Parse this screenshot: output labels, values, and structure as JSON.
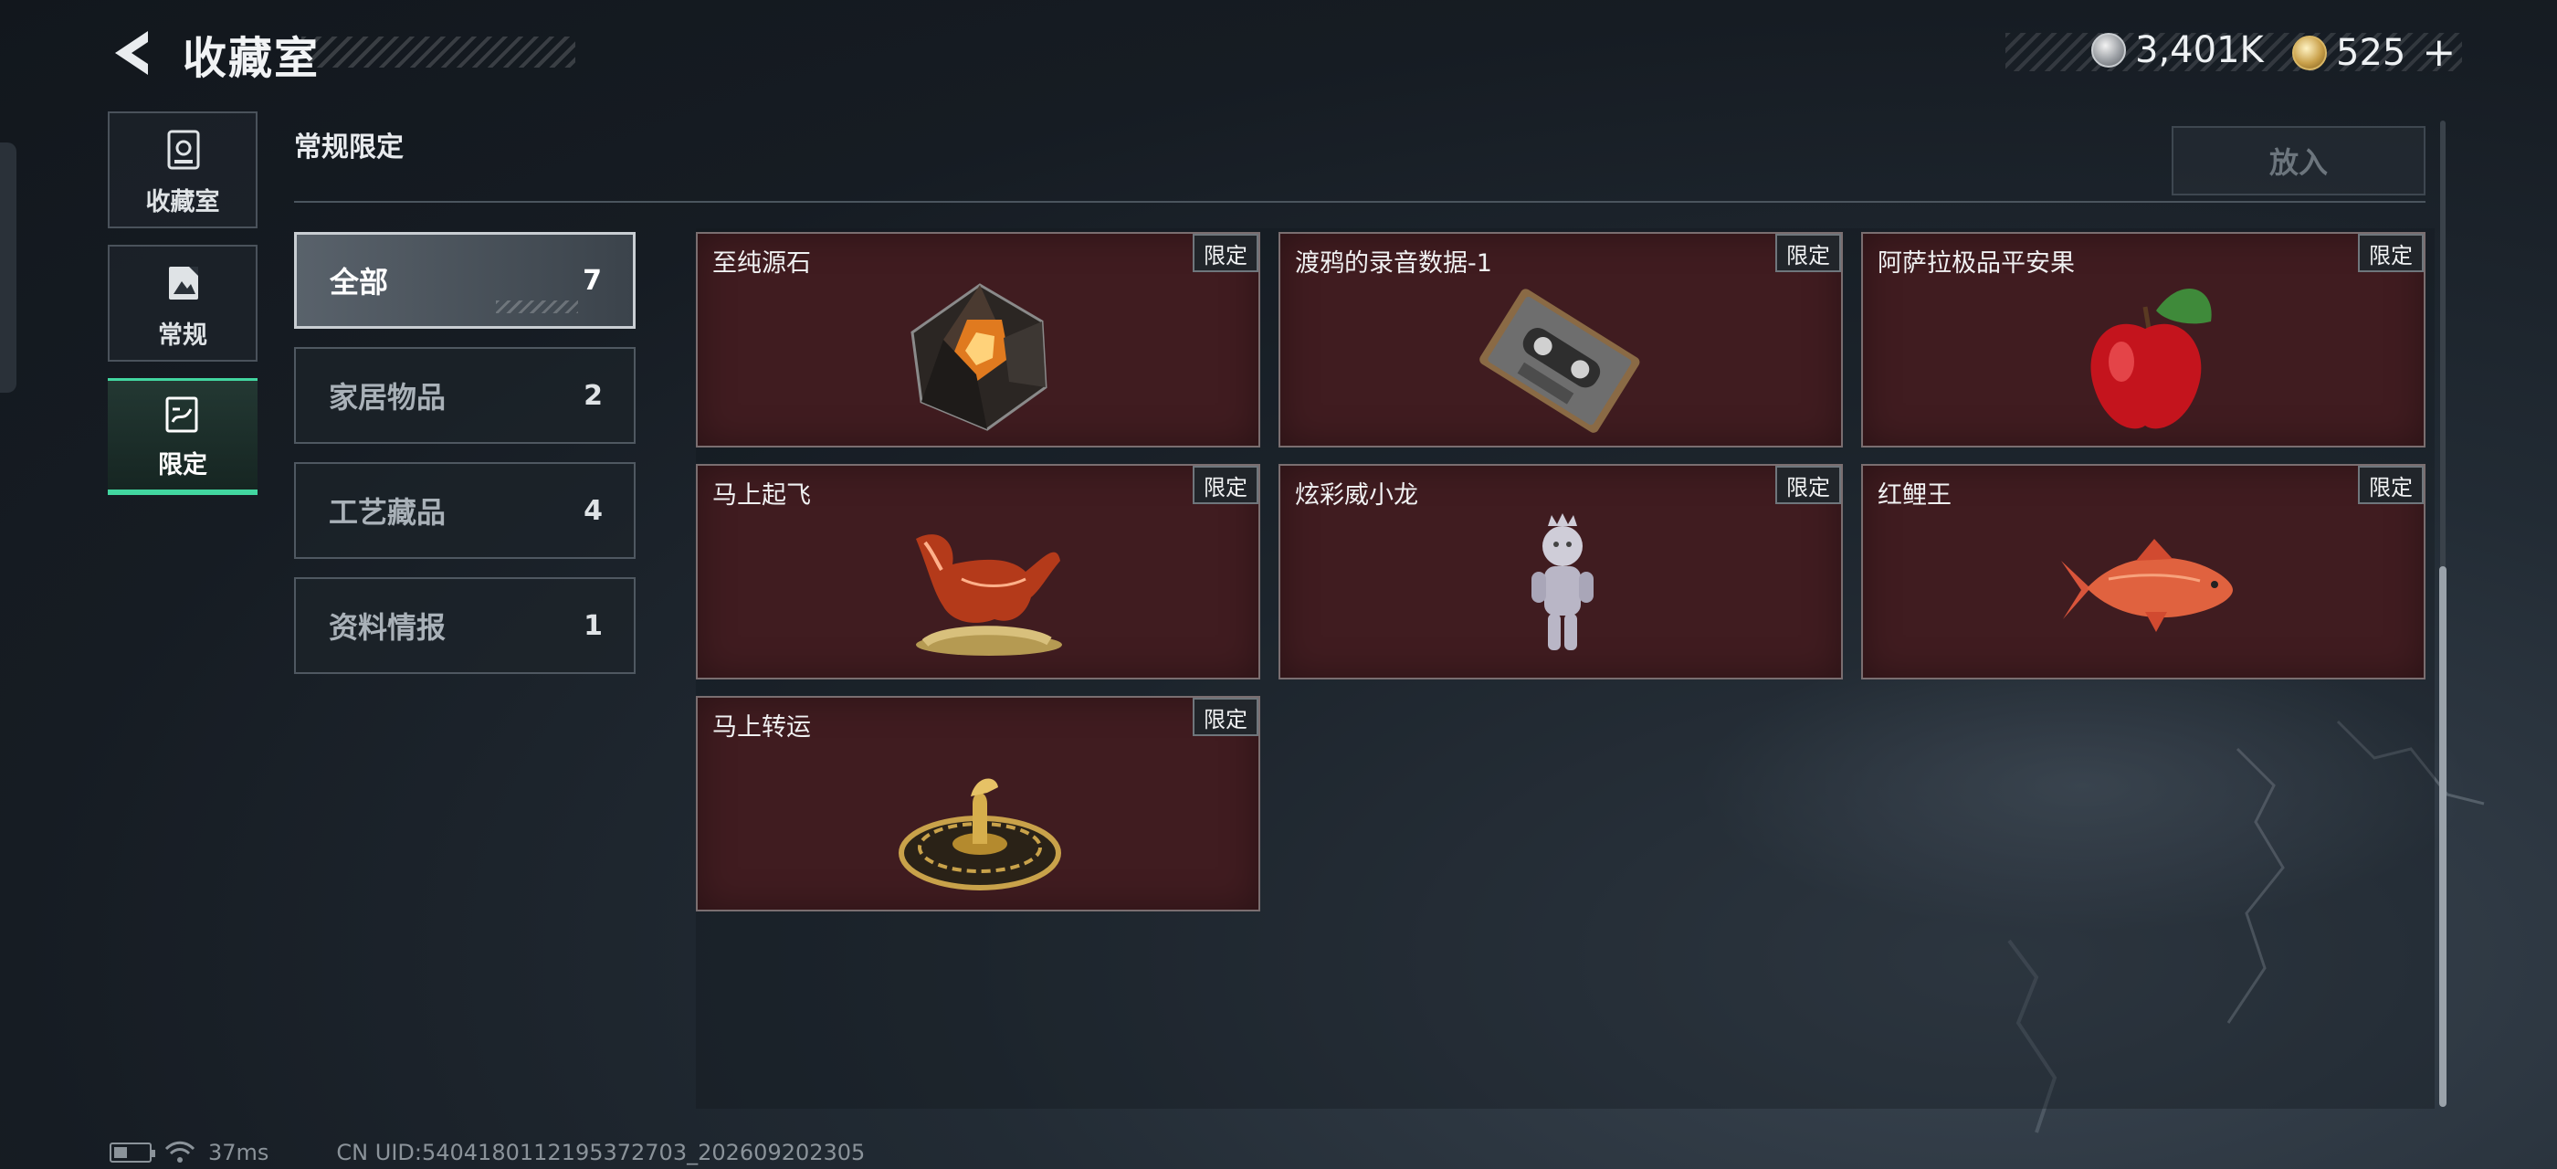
{
  "header": {
    "title": "收藏室",
    "currency_silver": "3,401K",
    "currency_gold": "525",
    "plus_label": "+"
  },
  "leftnav": {
    "items": [
      {
        "label": "收藏室",
        "icon": "vault-icon",
        "active": false
      },
      {
        "label": "常规",
        "icon": "picture-icon",
        "active": false
      },
      {
        "label": "限定",
        "icon": "limited-icon",
        "active": true
      }
    ]
  },
  "section": {
    "title": "常规限定",
    "place_button": "放入"
  },
  "categories": [
    {
      "label": "全部",
      "count": "7",
      "active": true
    },
    {
      "label": "家居物品",
      "count": "2",
      "active": false
    },
    {
      "label": "工艺藏品",
      "count": "4",
      "active": false
    },
    {
      "label": "资料情报",
      "count": "1",
      "active": false
    }
  ],
  "items": [
    {
      "name": "至纯源石",
      "tag": "限定",
      "art": "gem-icon"
    },
    {
      "name": "渡鸦的录音数据-1",
      "tag": "限定",
      "art": "cassette-icon"
    },
    {
      "name": "阿萨拉极品平安果",
      "tag": "限定",
      "art": "apple-icon"
    },
    {
      "name": "马上起飞",
      "tag": "限定",
      "art": "horse-icon"
    },
    {
      "name": "炫彩威小龙",
      "tag": "限定",
      "art": "dragon-figure-icon"
    },
    {
      "name": "红鲤王",
      "tag": "限定",
      "art": "carp-icon"
    },
    {
      "name": "马上转运",
      "tag": "限定",
      "art": "spinner-icon"
    }
  ],
  "footer": {
    "ping": "37ms",
    "uid": "CN UID:5404180112195372703_202609202305"
  },
  "colors": {
    "accent": "#42d6a0",
    "card_bg": "#401c20",
    "background": "#1b222a"
  }
}
